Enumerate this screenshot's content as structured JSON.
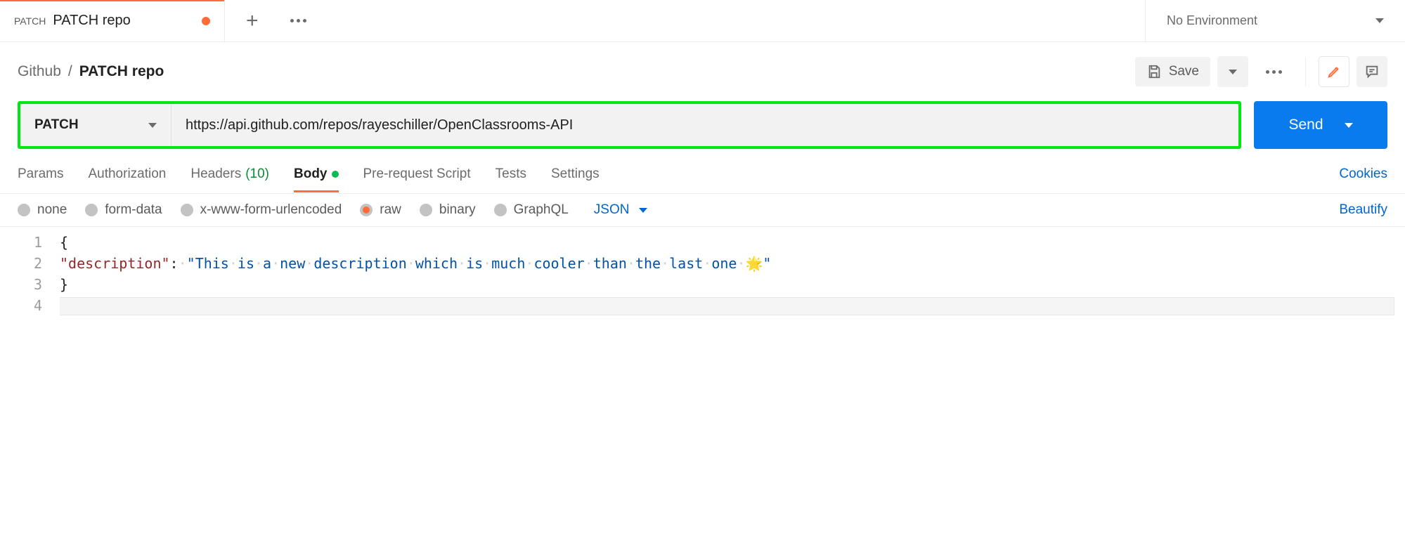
{
  "tab": {
    "method": "PATCH",
    "name": "PATCH repo"
  },
  "environment": {
    "selected": "No Environment"
  },
  "breadcrumb": {
    "parent": "Github",
    "current": "PATCH repo",
    "sep": "/"
  },
  "toolbar": {
    "save_label": "Save"
  },
  "request": {
    "method": "PATCH",
    "url": "https://api.github.com/repos/rayeschiller/OpenClassrooms-API",
    "send_label": "Send"
  },
  "request_tabs": {
    "params": "Params",
    "authorization": "Authorization",
    "headers": "Headers",
    "headers_count": "(10)",
    "body": "Body",
    "prerequest": "Pre-request Script",
    "tests": "Tests",
    "settings": "Settings",
    "cookies": "Cookies"
  },
  "body_types": {
    "none": "none",
    "formdata": "form-data",
    "urlencoded": "x-www-form-urlencoded",
    "raw": "raw",
    "binary": "binary",
    "graphql": "GraphQL",
    "lang": "JSON",
    "beautify": "Beautify"
  },
  "editor": {
    "lines": [
      "1",
      "2",
      "3",
      "4"
    ],
    "l1": "{",
    "l2_key": "\"description\"",
    "l2_colon": ":",
    "l2_val": "\"This is a new description which is much cooler than the last one 🌟\"",
    "l3": "}"
  }
}
